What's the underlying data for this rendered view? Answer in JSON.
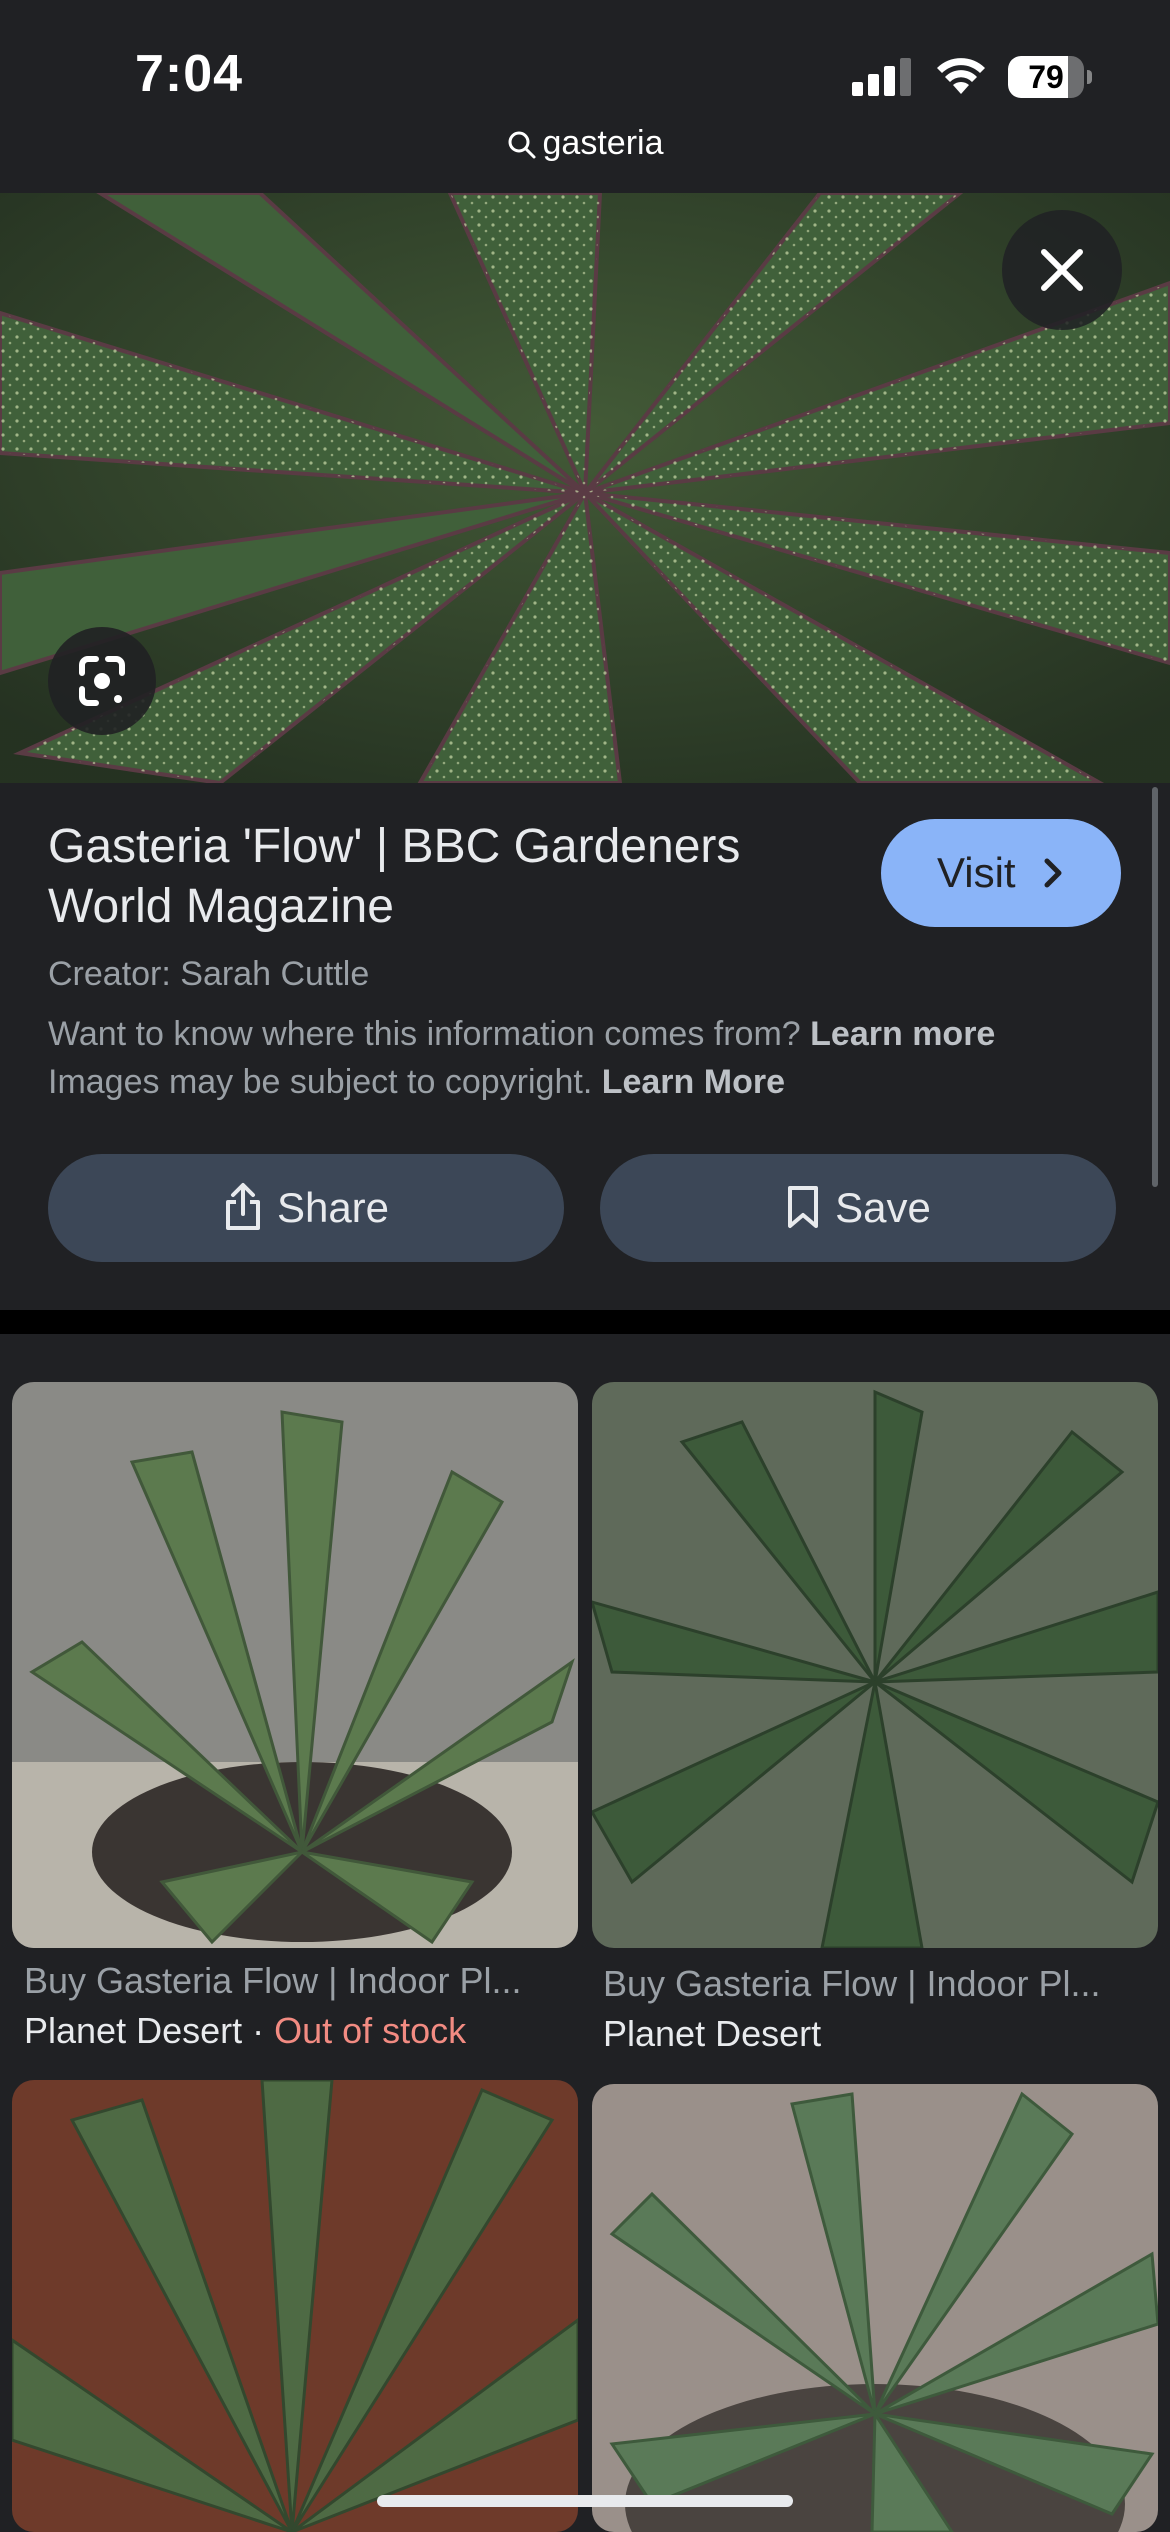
{
  "status_bar": {
    "time": "7:04",
    "battery_level": 79,
    "battery_text": "79",
    "signal_bars": 3
  },
  "search": {
    "query": "gasteria",
    "icon": "search-icon"
  },
  "hero": {
    "description_icon": "plant-image",
    "close_icon": "close-icon",
    "lens_icon": "google-lens-icon"
  },
  "result": {
    "title": "Gasteria 'Flow' | BBC Gardeners World Magazine",
    "visit_label": "Visit",
    "creator": "Creator: Sarah Cuttle",
    "info_prefix": "Want to know where this information comes from?",
    "info_link": "Learn more",
    "copyright_prefix": "Images may be subject to copyright.",
    "copyright_link": "Learn More",
    "share_label": "Share",
    "save_label": "Save"
  },
  "related": [
    {
      "title": "Buy Gasteria Flow | Indoor Pl...",
      "source": "Planet Desert",
      "separator": " · ",
      "stock": "Out of stock"
    },
    {
      "title": "Buy Gasteria Flow | Indoor Pl...",
      "source": "Planet Desert",
      "separator": "",
      "stock": ""
    },
    {
      "title": "",
      "source": "",
      "separator": "",
      "stock": ""
    },
    {
      "title": "",
      "source": "",
      "separator": "",
      "stock": ""
    }
  ],
  "colors": {
    "accent": "#8ab4f8",
    "background": "#202124",
    "button": "#3c4757",
    "stock_warning": "#f28b82"
  }
}
